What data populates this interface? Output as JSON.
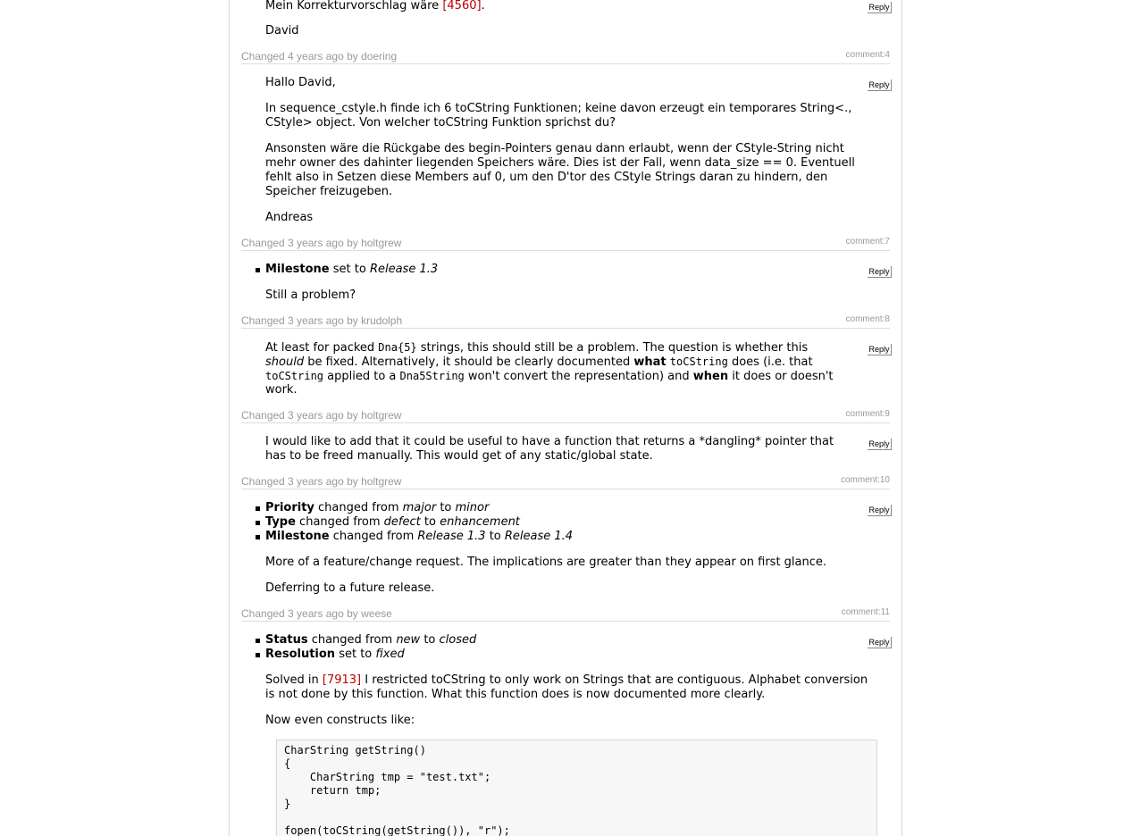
{
  "reply_label": "Reply",
  "top": {
    "line1_pre": "Mein Korrekturvorschlag wäre ",
    "line1_link": "[4560]",
    "line1_post": ".",
    "sign": "David"
  },
  "c4": {
    "prefix": "Changed ",
    "when": "4 years ago",
    "by": " by ",
    "author": "doering",
    "id": "comment:4",
    "p1": "Hallo David,",
    "p2a": "In sequence_cstyle.h finde ich 6 toCString Funktionen; keine davon erzeugt ein temporares String<.,",
    "p2b": "CStyle> object. Von welcher toCString Funktion sprichst du?",
    "p3a": "Ansonsten wäre die Rückgabe des begin-Pointers genau dann erlaubt, wenn der CStyle-String nicht",
    "p3b": "mehr owner des dahinter liegenden Speichers wäre. Dies ist der Fall, wenn data_size == 0. Eventuell",
    "p3c": "fehlt also in Setzen diese Members auf 0, um den D'tor des CStyle Strings daran zu hindern, den",
    "p3d": "Speicher freizugeben.",
    "sign": "Andreas"
  },
  "c7": {
    "prefix": "Changed ",
    "when": "3 years ago",
    "by": " by ",
    "author": "holtgrew",
    "id": "comment:7",
    "f1_name": "Milestone",
    "f1_verb": " set to ",
    "f1_val": "Release 1.3",
    "p1": "Still a problem?"
  },
  "c8": {
    "prefix": "Changed ",
    "when": "3 years ago",
    "by": " by ",
    "author": "krudolph",
    "id": "comment:8",
    "l1a": "At least for packed ",
    "l1code": "Dna{5}",
    "l1b": " strings, this should still be a problem. The question is whether this",
    "l2em": "should",
    "l2a": " be fixed. Alternatively, it should be clearly documented ",
    "l2b1": "what",
    "l2sp": " ",
    "l2code": "toCString",
    "l2c": " does (i.e. that",
    "l3code1": "toCString",
    "l3a": " applied to a ",
    "l3code2": "Dna5String",
    "l3b": " won't convert the representation) and ",
    "l3b2": "when",
    "l3c": " it does or doesn't",
    "l4": "work."
  },
  "c9": {
    "prefix": "Changed ",
    "when": "3 years ago",
    "by": " by ",
    "author": "holtgrew",
    "id": "comment:9",
    "l1": "I would like to add that it could be useful to have a function that returns a *dangling* pointer that",
    "l2": "has to be freed manually. This would get of any static/global state."
  },
  "c10": {
    "prefix": "Changed ",
    "when": "3 years ago",
    "by": " by ",
    "author": "holtgrew",
    "id": "comment:10",
    "f1_name": "Priority",
    "f1_verb": " changed from ",
    "f1_from": "major",
    "f1_to_word": " to ",
    "f1_to": "minor",
    "f2_name": "Type",
    "f2_verb": " changed from ",
    "f2_from": "defect",
    "f2_to_word": " to ",
    "f2_to": "enhancement",
    "f3_name": "Milestone",
    "f3_verb": " changed from ",
    "f3_from": "Release 1.3",
    "f3_to_word": " to ",
    "f3_to": "Release 1.4",
    "p1": "More of a feature/change request. The implications are greater than they appear on first glance.",
    "p2": "Deferring to a future release."
  },
  "c11": {
    "prefix": "Changed ",
    "when": "3 years ago",
    "by": " by ",
    "author": "weese",
    "id": "comment:11",
    "f1_name": "Status",
    "f1_verb": " changed from ",
    "f1_from": "new",
    "f1_to_word": " to ",
    "f1_to": "closed",
    "f2_name": "Resolution",
    "f2_verb": " set to ",
    "f2_val": "fixed",
    "l1a": "Solved in ",
    "l1link": "[7913]",
    "l1b": " I restricted toCString to only work on Strings that are contiguous. Alphabet conversion",
    "l2": "is not done by this function. What this function does is now documented more clearly.",
    "p2": "Now even constructs like:",
    "code": [
      "CharString getString()",
      "{",
      "    CharString tmp = \"test.txt\";",
      "    return tmp;",
      "}",
      "",
      "fopen(toCString(getString()), \"r\");"
    ]
  }
}
